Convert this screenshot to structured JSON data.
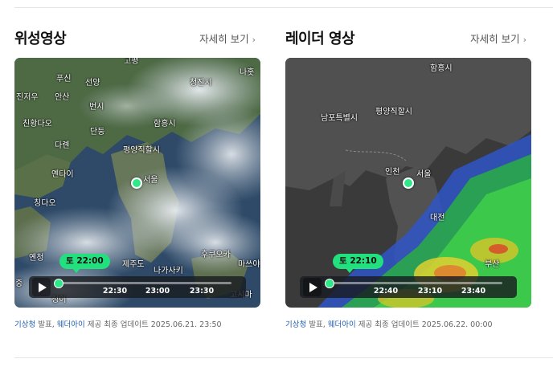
{
  "cards": [
    {
      "title": "위성영상",
      "more_label": "자세히 보기",
      "time_bubble": "토 22:00",
      "progress": 0.0,
      "ticks": [
        "22:30",
        "23:00",
        "23:30"
      ],
      "map_labels": [
        "나홋",
        "고평",
        "푸신",
        "선양",
        "청진시",
        "진저우",
        "안산",
        "번시",
        "친황다오",
        "단둥",
        "함흥시",
        "다롄",
        "평양직할시",
        "옌타이",
        "서울",
        "칭다오",
        "옌청",
        "제주도",
        "나가사키",
        "후쿠오카",
        "마쓰야",
        "고시마",
        "중",
        "청이"
      ],
      "caption": {
        "src1": "기상청",
        "t1": " 발표, ",
        "src2": "웨더아이",
        "t2": " 제공 최종 업데이트 2025.06.21. 23:50"
      }
    },
    {
      "title": "레이더 영상",
      "more_label": "자세히 보기",
      "time_bubble": "토 22:10",
      "progress": 0.0,
      "ticks": [
        "22:40",
        "23:10",
        "23:40"
      ],
      "map_labels": [
        "함흥시",
        "남포특별시",
        "평양직할시",
        "인천",
        "서울",
        "대전",
        "부산"
      ],
      "caption": {
        "src1": "기상청",
        "t1": " 발표, ",
        "src2": "웨더아이",
        "t2": " 제공 최종 업데이트 2025.06.22. 00:00"
      }
    }
  ],
  "icons": {
    "play": "play-icon",
    "chevron": "chevron-right-icon"
  },
  "colors": {
    "accent": "#21e07d",
    "link": "#1f5fae",
    "radar_bg": "#3a3a3a"
  }
}
